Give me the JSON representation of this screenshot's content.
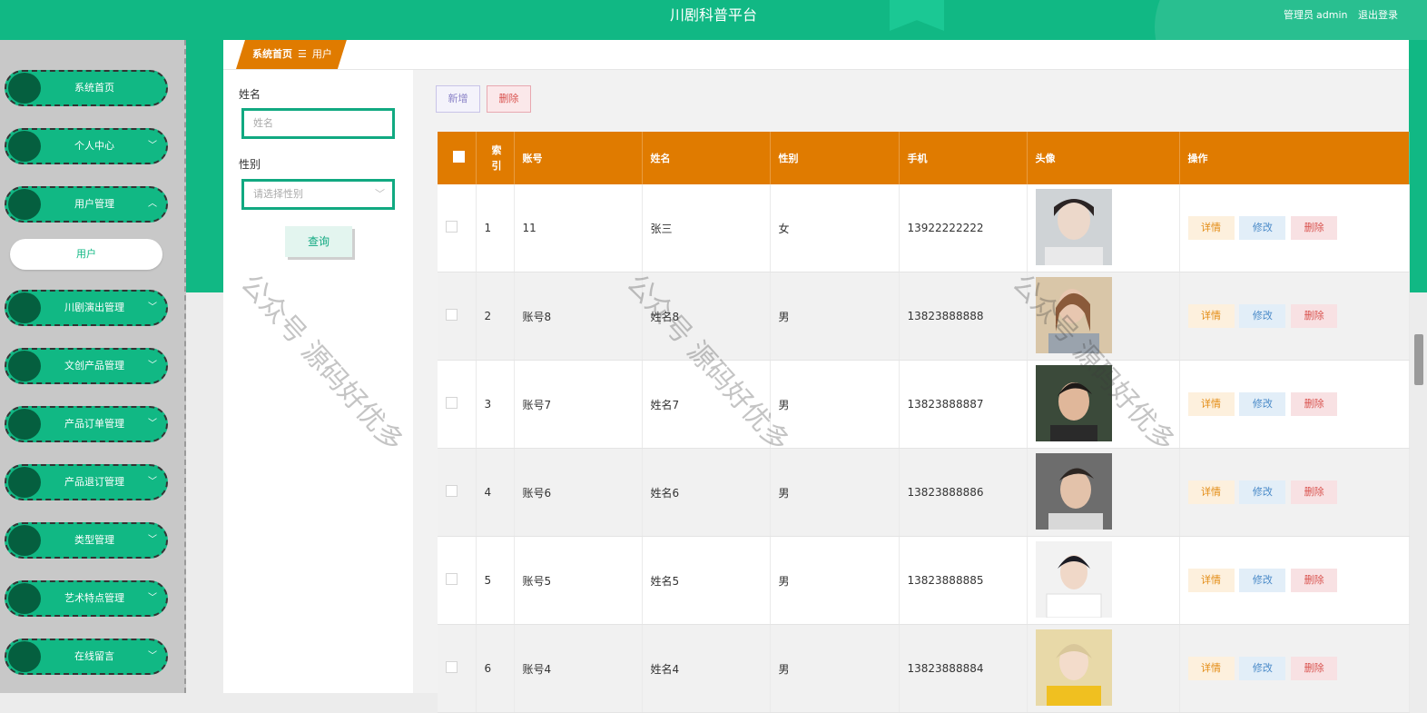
{
  "header": {
    "title": "川剧科普平台",
    "role": "管理员",
    "username": "admin",
    "logout": "退出登录"
  },
  "sidebar": {
    "items": [
      {
        "label": "系统首页",
        "chevron": ""
      },
      {
        "label": "个人中心",
        "chevron": "﹀"
      },
      {
        "label": "用户管理",
        "chevron": "︿"
      },
      {
        "label": "川剧演出管理",
        "chevron": "﹀"
      },
      {
        "label": "文创产品管理",
        "chevron": "﹀"
      },
      {
        "label": "产品订单管理",
        "chevron": "﹀"
      },
      {
        "label": "产品退订管理",
        "chevron": "﹀"
      },
      {
        "label": "类型管理",
        "chevron": "﹀"
      },
      {
        "label": "艺术特点管理",
        "chevron": "﹀"
      },
      {
        "label": "在线留言",
        "chevron": "﹀"
      }
    ],
    "sub_item": "用户"
  },
  "breadcrumb": {
    "home": "系统首页",
    "separator": "☰",
    "current": "用户"
  },
  "search": {
    "name_label": "姓名",
    "name_placeholder": "姓名",
    "gender_label": "性别",
    "gender_placeholder": "请选择性别",
    "query_button": "查询"
  },
  "toolbar": {
    "add": "新增",
    "delete": "删除"
  },
  "table": {
    "headers": [
      "",
      "索引",
      "账号",
      "姓名",
      "性别",
      "手机",
      "头像",
      "操作"
    ],
    "rows": [
      {
        "index": "1",
        "account": "11",
        "name": "张三",
        "gender": "女",
        "phone": "13922222222"
      },
      {
        "index": "2",
        "account": "账号8",
        "name": "姓名8",
        "gender": "男",
        "phone": "13823888888"
      },
      {
        "index": "3",
        "account": "账号7",
        "name": "姓名7",
        "gender": "男",
        "phone": "13823888887"
      },
      {
        "index": "4",
        "account": "账号6",
        "name": "姓名6",
        "gender": "男",
        "phone": "13823888886"
      },
      {
        "index": "5",
        "account": "账号5",
        "name": "姓名5",
        "gender": "男",
        "phone": "13823888885"
      },
      {
        "index": "6",
        "account": "账号4",
        "name": "姓名4",
        "gender": "男",
        "phone": "13823888884"
      }
    ],
    "actions": {
      "detail": "详情",
      "edit": "修改",
      "delete": "删除"
    }
  },
  "watermark": "公众号 源码好优多",
  "colors": {
    "primary": "#11b884",
    "table_header": "#e07b00",
    "sidebar_bg": "#c8c8c8"
  }
}
